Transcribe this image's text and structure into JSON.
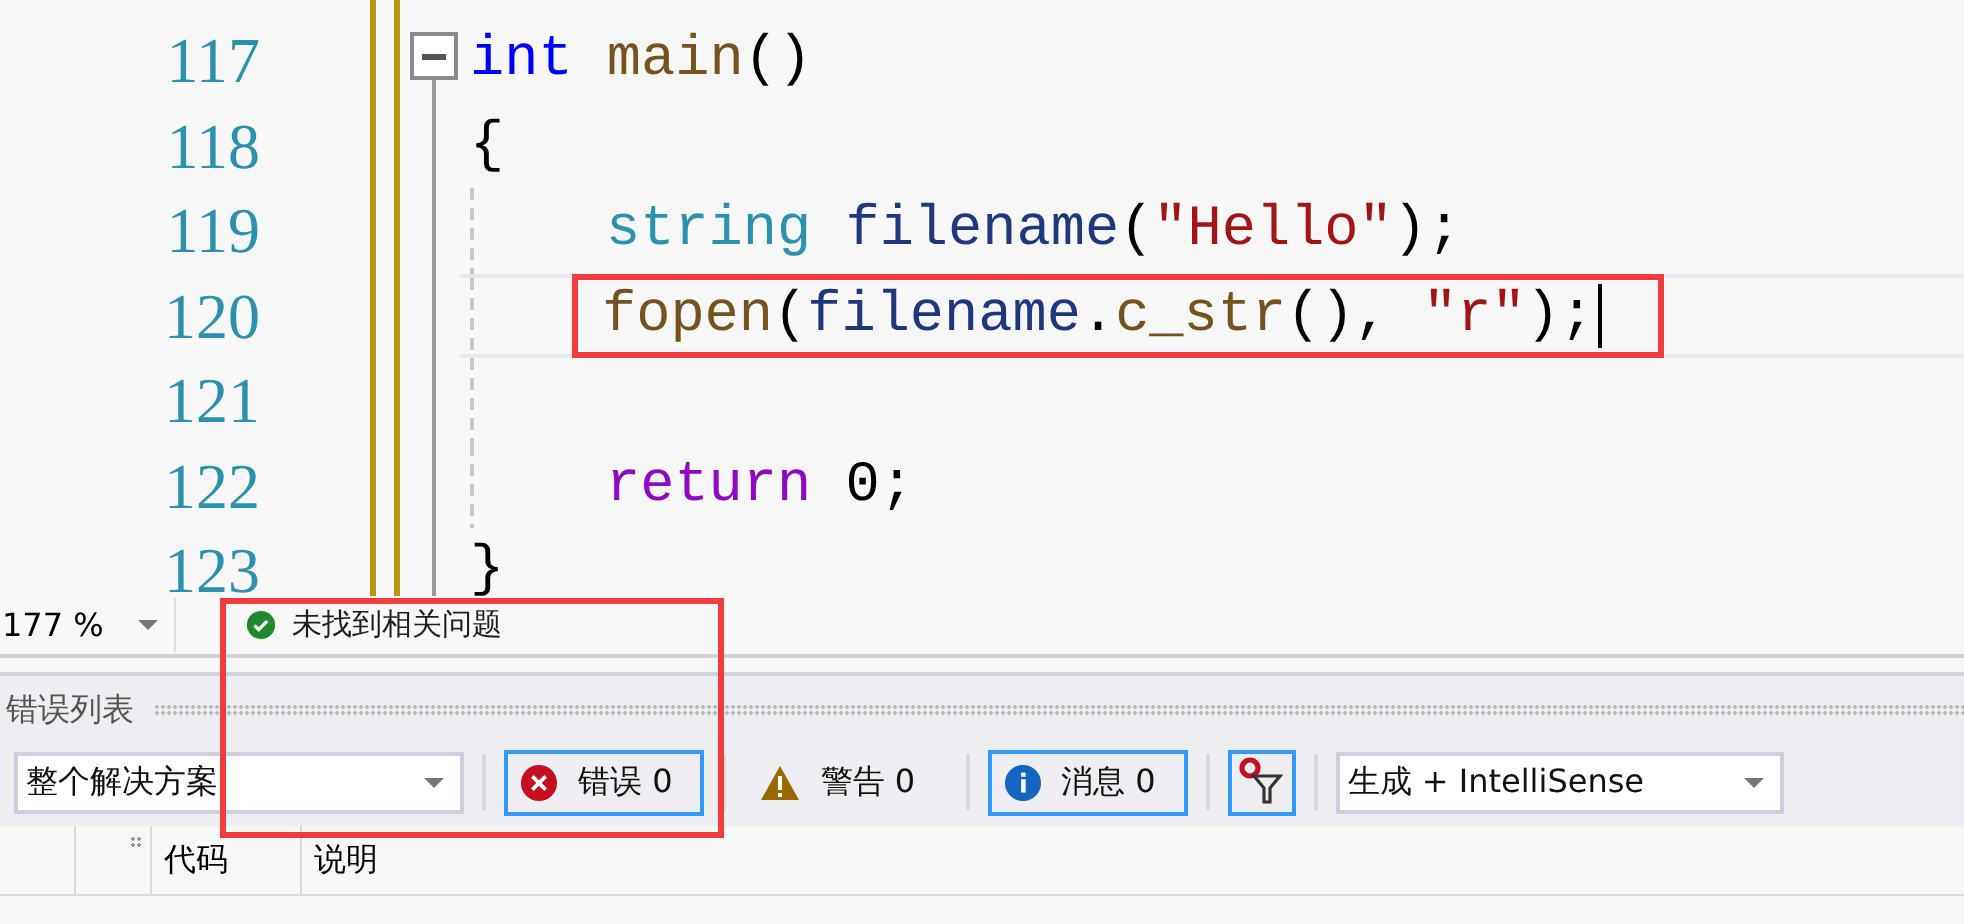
{
  "editor": {
    "lines": [
      {
        "number": "117",
        "collapsible": true,
        "tokens": [
          {
            "kind": "keyword",
            "text": "int"
          },
          {
            "kind": "function",
            "text": " main"
          },
          {
            "kind": "punct",
            "text": "()"
          }
        ]
      },
      {
        "number": "118",
        "tokens": [
          {
            "kind": "punct",
            "text": "{"
          }
        ]
      },
      {
        "number": "119",
        "indented": true,
        "tokens": [
          {
            "kind": "type",
            "text": "string"
          },
          {
            "kind": "variable",
            "text": " filename"
          },
          {
            "kind": "punct",
            "text": "("
          },
          {
            "kind": "string",
            "text": "\"Hello\""
          },
          {
            "kind": "punct",
            "text": ");"
          }
        ]
      },
      {
        "number": "120",
        "indented": true,
        "current": true,
        "annotated": true,
        "caret": true,
        "tokens": [
          {
            "kind": "function",
            "text": "fopen"
          },
          {
            "kind": "punct",
            "text": "("
          },
          {
            "kind": "variable",
            "text": "filename"
          },
          {
            "kind": "punct",
            "text": "."
          },
          {
            "kind": "function",
            "text": "c_str"
          },
          {
            "kind": "punct",
            "text": "(), "
          },
          {
            "kind": "string",
            "text": "\"r\""
          },
          {
            "kind": "punct",
            "text": ");"
          }
        ]
      },
      {
        "number": "121",
        "indented": true
      },
      {
        "number": "122",
        "indented": true,
        "tokens": [
          {
            "kind": "control",
            "text": "return"
          },
          {
            "kind": "punct",
            "text": " 0;"
          }
        ]
      },
      {
        "number": "123",
        "tokens": [
          {
            "kind": "punct",
            "text": "}"
          }
        ]
      }
    ]
  },
  "status_row": {
    "zoom": "177 %",
    "message": "未找到相关问题",
    "annotated": true
  },
  "error_list": {
    "title": "错误列表",
    "scope": "整个解决方案",
    "filters": [
      {
        "kind": "error",
        "label": "错误 0",
        "selected": true
      },
      {
        "kind": "warning",
        "label": "警告 0",
        "selected": false
      },
      {
        "kind": "info",
        "label": "消息 0",
        "selected": true
      }
    ],
    "filter_toggle": {
      "on": true
    },
    "source": "生成 + IntelliSense",
    "columns": [
      "代码",
      "说明"
    ]
  }
}
